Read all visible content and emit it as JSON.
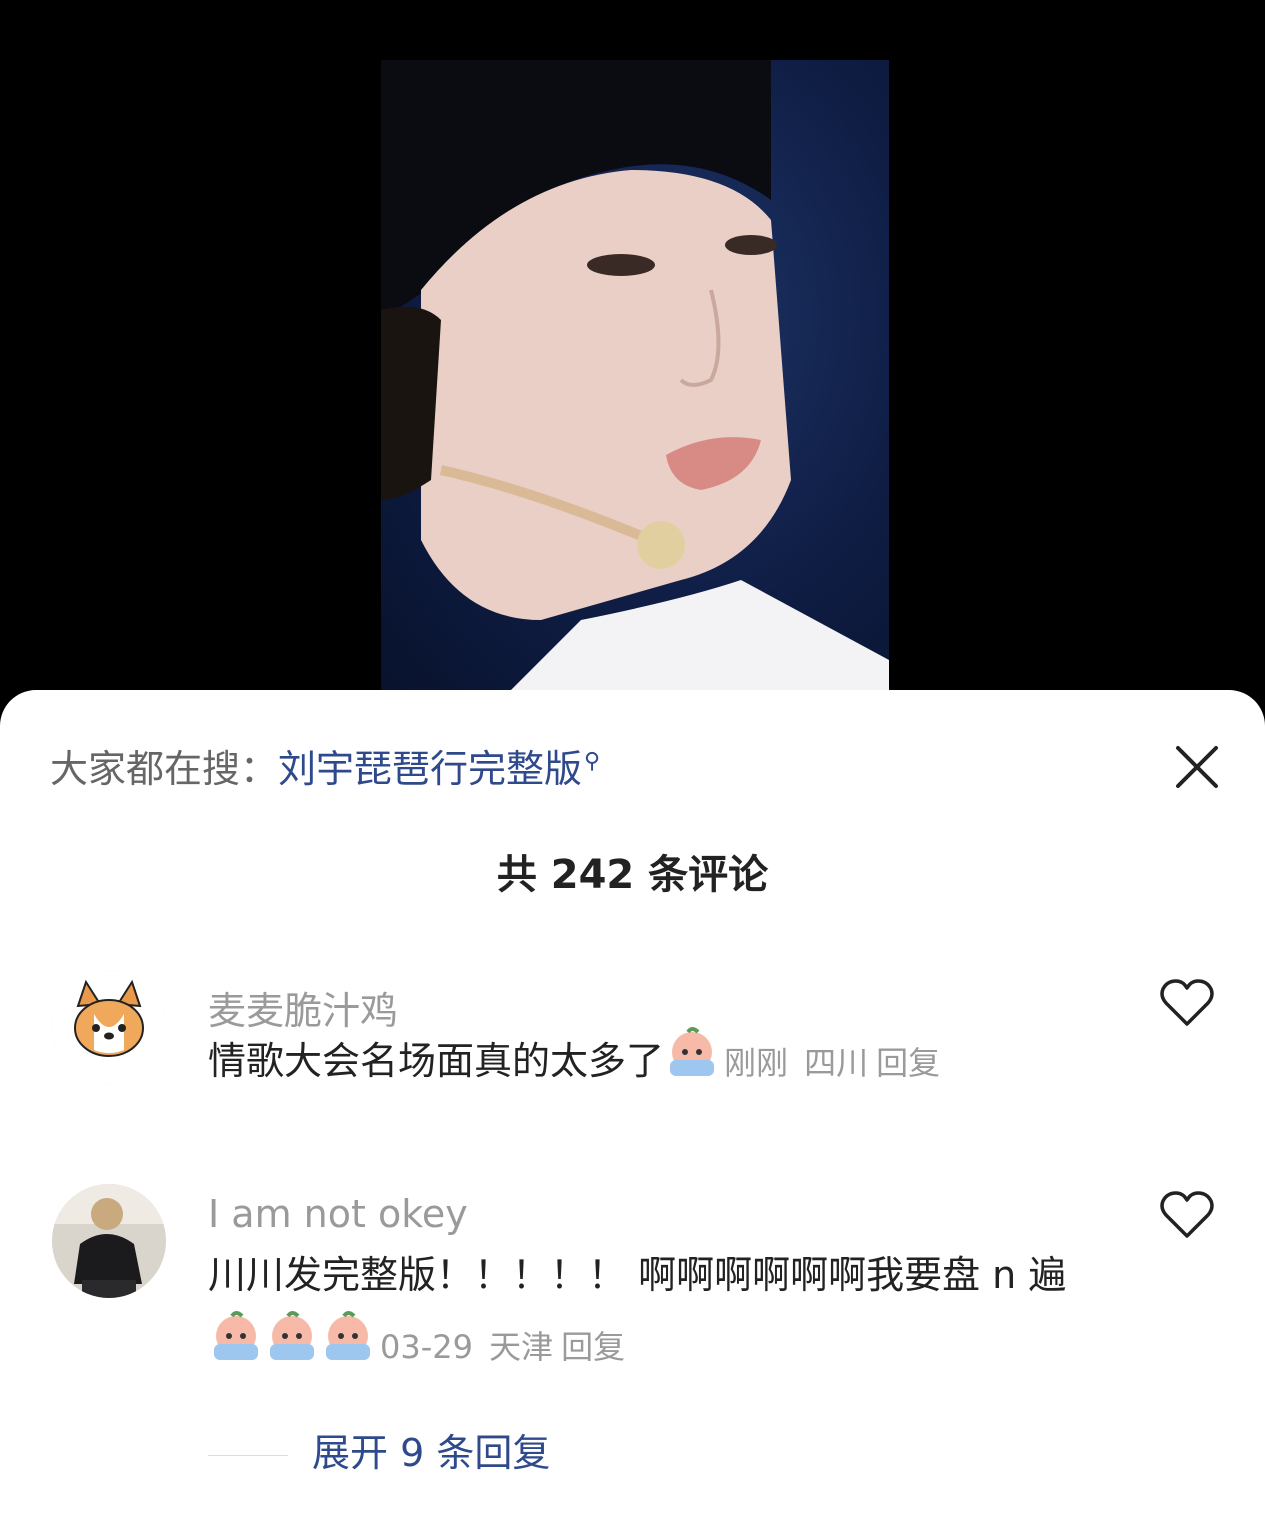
{
  "search": {
    "prefix": "大家都在搜：",
    "query": "刘宇琵琶行完整版"
  },
  "comments_count": "共 242 条评论",
  "comments": [
    {
      "user": "麦麦脆汁鸡",
      "text": "情歌大会名场面真的太多了",
      "time": "刚刚",
      "location": "四川",
      "reply": "回复"
    },
    {
      "user": "I am not okey",
      "text": "川川发完整版！！！！！ 啊啊啊啊啊啊我要盘 n 遍",
      "time": "03-29",
      "location": "天津",
      "reply": "回复"
    }
  ],
  "expand_replies": "展开 9 条回复",
  "colors": {
    "link": "#2f4a8c",
    "muted": "#9a9a9a",
    "text": "#222222"
  }
}
